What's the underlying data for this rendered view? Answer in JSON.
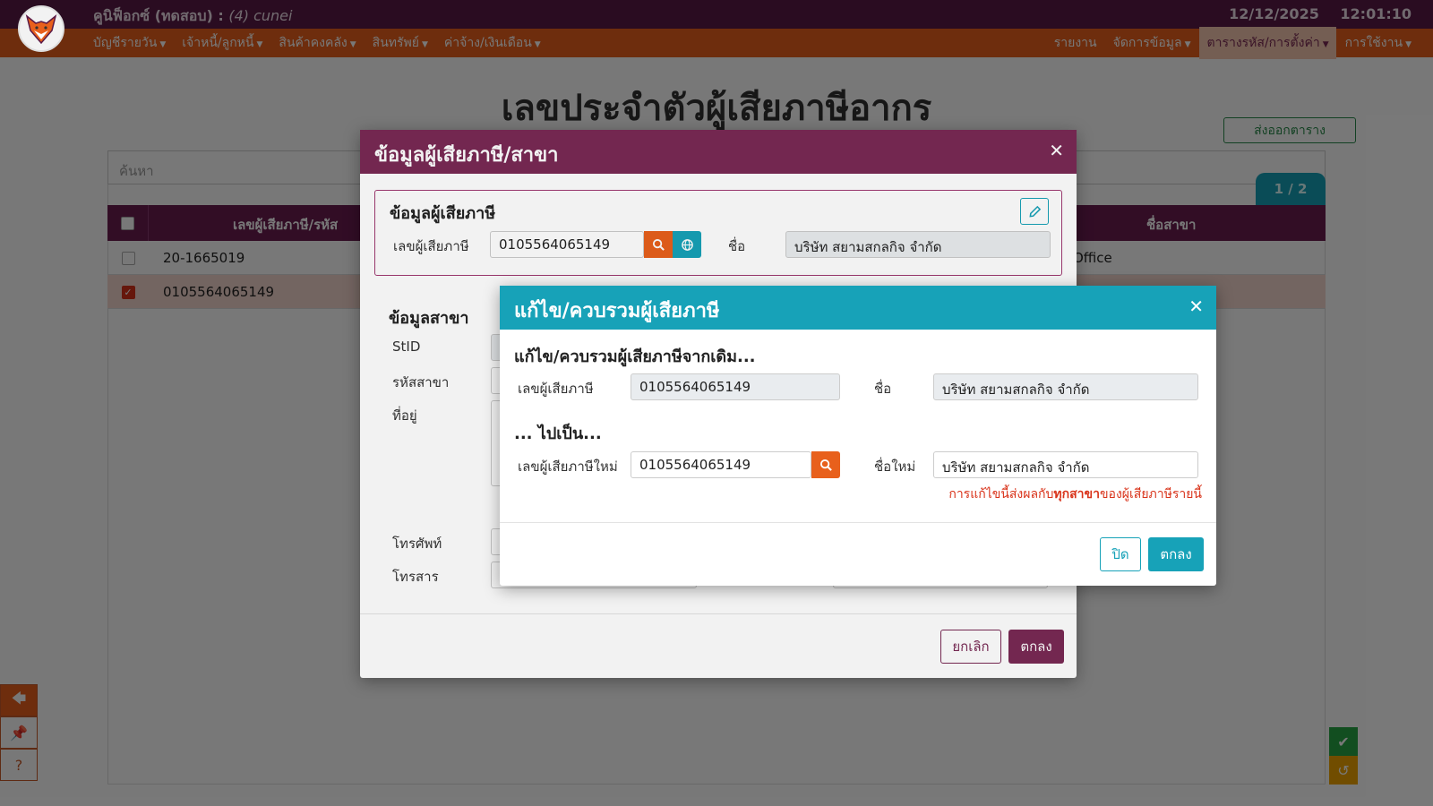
{
  "app": {
    "title": "คูนิฟ็อกซ์ (ทดสอบ) :",
    "user": "(4) cunei",
    "date": "12/12/2025",
    "time": "12:01:10"
  },
  "menu": {
    "left": [
      "บัญชีรายวัน",
      "เจ้าหนี้/ลูกหนี้",
      "สินค้าคงคลัง",
      "สินทรัพย์",
      "ค่าจ้าง/เงินเดือน"
    ],
    "right": {
      "report": "รายงาน",
      "manage": "จัดการข้อมูล",
      "tables": "ตารางรหัส/การตั้งค่า",
      "usage": "การใช้งาน"
    }
  },
  "page": {
    "title": "เลขประจำตัวผู้เสียภาษีอากร",
    "export_label": "ส่งออกตาราง",
    "search_placeholder": "ค้นหา",
    "pager": "1 / 2",
    "columns": {
      "taxid": "เลขผู้เสียภาษี/รหัส",
      "branch_name": "ชื่อสาขา"
    },
    "rows": [
      {
        "taxid": "20-1665019",
        "branch": "Office",
        "checked": false
      },
      {
        "taxid": "0105564065149",
        "branch": "",
        "checked": true
      }
    ]
  },
  "modal1": {
    "title": "ข้อมูลผู้เสียภาษี/สาขา",
    "taxpayer_section": "ข้อมูลผู้เสียภาษี",
    "taxid_label": "เลขผู้เสียภาษี",
    "taxid_value": "0105564065149",
    "name_label": "ชื่อ",
    "name_value": "บริษัท สยามสกลกิจ จำกัด",
    "branch_section": "ข้อมูลสาขา",
    "stid_label": "StID",
    "branch_code_label": "รหัสสาขา",
    "address_label": "ที่อยู่",
    "phone_label": "โทรศัพท์",
    "fax_label": "โทรสาร",
    "cancel_label": "ยกเลิก",
    "ok_label": "ตกลง"
  },
  "modal2": {
    "title": "แก้ไข/ควบรวมผู้เสียภาษี",
    "from_section": "แก้ไข/ควบรวมผู้เสียภาษีจากเดิม...",
    "old_taxid_label": "เลขผู้เสียภาษี",
    "old_taxid_value": "0105564065149",
    "old_name_label": "ชื่อ",
    "old_name_value": "บริษัท สยามสกลกิจ จำกัด",
    "to_section": "... ไปเป็น...",
    "new_taxid_label": "เลขผู้เสียภาษีใหม่",
    "new_taxid_value": "0105564065149",
    "new_name_label": "ชื่อใหม่",
    "new_name_value": "บริษัท สยามสกลกิจ จำกัด",
    "warning_pre": "การแก้ไขนี้ส่งผลกับ",
    "warning_bold": "ทุกสาขา",
    "warning_post": "ของผู้เสียภาษีรายนี้",
    "close_label": "ปิด",
    "ok_label": "ตกลง"
  },
  "colors": {
    "brand_purple": "#7a2a55",
    "brand_orange": "#e8601c",
    "accent_teal": "#17a2b8",
    "warning_red": "#d9331a"
  },
  "icons": [
    "fox-logo-icon",
    "search-icon",
    "globe-icon",
    "edit-icon",
    "close-icon",
    "back-arrow-icon",
    "pin-icon",
    "help-icon",
    "check-icon",
    "undo-icon"
  ]
}
